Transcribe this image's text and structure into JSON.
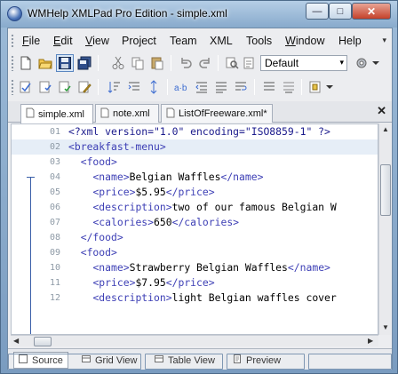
{
  "window": {
    "title": "WMHelp XMLPad Pro Edition - simple.xml",
    "minimize_glyph": "—",
    "maximize_glyph": "□",
    "close_glyph": "✕"
  },
  "menu": {
    "items": [
      {
        "label": "File",
        "mnemonic": "F"
      },
      {
        "label": "Edit",
        "mnemonic": "E"
      },
      {
        "label": "View",
        "mnemonic": "V"
      },
      {
        "label": "Project",
        "mnemonic": ""
      },
      {
        "label": "Team",
        "mnemonic": ""
      },
      {
        "label": "XML",
        "mnemonic": ""
      },
      {
        "label": "Tools",
        "mnemonic": ""
      },
      {
        "label": "Window",
        "mnemonic": "W"
      },
      {
        "label": "Help",
        "mnemonic": ""
      }
    ],
    "overflow_glyph": "▾"
  },
  "toolbar": {
    "encoding_combo_value": "Default",
    "combo_arrow": "▾"
  },
  "tabs": [
    {
      "label": "simple.xml",
      "active": true
    },
    {
      "label": "note.xml",
      "active": false
    },
    {
      "label": "ListOfFreeware.xml*",
      "active": false
    }
  ],
  "tab_close_glyph": "✕",
  "editor": {
    "lines": [
      {
        "num": "01",
        "indent": "",
        "tokens": [
          [
            "attr",
            "<?xml version=\"1.0\" encoding=\"ISO8859-1\" ?>"
          ]
        ]
      },
      {
        "num": "02",
        "indent": "",
        "tokens": [
          [
            "tag",
            "<breakfast-menu>"
          ]
        ],
        "highlight": true
      },
      {
        "num": "03",
        "indent": "  ",
        "tokens": [
          [
            "tag",
            "<food>"
          ]
        ]
      },
      {
        "num": "04",
        "indent": "    ",
        "tokens": [
          [
            "tag",
            "<name>"
          ],
          [
            "text",
            "Belgian Waffles"
          ],
          [
            "tag",
            "</name>"
          ]
        ]
      },
      {
        "num": "05",
        "indent": "    ",
        "tokens": [
          [
            "tag",
            "<price>"
          ],
          [
            "text",
            "$5.95"
          ],
          [
            "tag",
            "</price>"
          ]
        ]
      },
      {
        "num": "06",
        "indent": "    ",
        "tokens": [
          [
            "tag",
            "<description>"
          ],
          [
            "text",
            "two of our famous Belgian W"
          ]
        ]
      },
      {
        "num": "07",
        "indent": "    ",
        "tokens": [
          [
            "tag",
            "<calories>"
          ],
          [
            "text",
            "650"
          ],
          [
            "tag",
            "</calories>"
          ]
        ]
      },
      {
        "num": "08",
        "indent": "  ",
        "tokens": [
          [
            "tag",
            "</food>"
          ]
        ]
      },
      {
        "num": "09",
        "indent": "  ",
        "tokens": [
          [
            "tag",
            "<food>"
          ]
        ]
      },
      {
        "num": "10",
        "indent": "    ",
        "tokens": [
          [
            "tag",
            "<name>"
          ],
          [
            "text",
            "Strawberry Belgian Waffles"
          ],
          [
            "tag",
            "</name>"
          ]
        ]
      },
      {
        "num": "11",
        "indent": "    ",
        "tokens": [
          [
            "tag",
            "<price>"
          ],
          [
            "text",
            "$7.95"
          ],
          [
            "tag",
            "</price>"
          ]
        ]
      },
      {
        "num": "12",
        "indent": "    ",
        "tokens": [
          [
            "tag",
            "<description>"
          ],
          [
            "text",
            "light Belgian waffles cover"
          ]
        ]
      }
    ]
  },
  "scroll_arrows": {
    "up": "▲",
    "down": "▼",
    "left": "◀",
    "right": "▶"
  },
  "view_tabs": [
    {
      "label": "Source",
      "active": true
    },
    {
      "label": "Grid View",
      "active": false
    },
    {
      "label": "Table View",
      "active": false
    },
    {
      "label": "Preview",
      "active": false
    }
  ],
  "colors": {
    "tag": "#3d3fb5",
    "text": "#000000",
    "line_highlight": "#e6eef7",
    "fold_guide": "#3a5fa8"
  }
}
